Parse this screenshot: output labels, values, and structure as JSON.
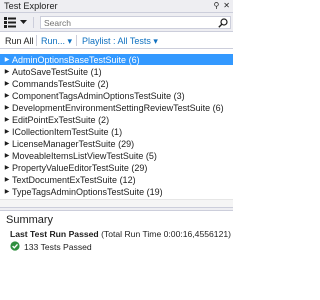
{
  "window": {
    "title": "Test Explorer",
    "pin_glyph": "⚲",
    "close_glyph": "✕"
  },
  "toolbar": {
    "group_by_icon": "group-by-icon",
    "dropdown_icon": "chevron-down-icon",
    "search": {
      "placeholder": "Search",
      "value": ""
    }
  },
  "commands": {
    "run_all": "Run All",
    "run": "Run...",
    "run_arrow": "▾",
    "playlist": "Playlist : All Tests",
    "playlist_arrow": "▾"
  },
  "colors": {
    "accent": "#0e70c0",
    "selection": "#3399ff",
    "passed": "#2f8f3f"
  },
  "tree": {
    "items": [
      {
        "name": "AdminOptionsBaseTestSuite",
        "count": "(6)",
        "selected": true
      },
      {
        "name": "AutoSaveTestSuite",
        "count": "(1)"
      },
      {
        "name": "CommandsTestSuite",
        "count": "(2)"
      },
      {
        "name": "ComponentTagsAdminOptionsTestSuite",
        "count": "(3)"
      },
      {
        "name": "DevelopmentEnvironmentSettingReviewTestSuite",
        "count": "(6)"
      },
      {
        "name": "EditPointExTestSuite",
        "count": "(2)"
      },
      {
        "name": "ICollectionItemTestSuite",
        "count": "(1)"
      },
      {
        "name": "LicenseManagerTestSuite",
        "count": "(29)"
      },
      {
        "name": "MoveableItemsListViewTestSuite",
        "count": "(5)"
      },
      {
        "name": "PropertyValueEditorTestSuite",
        "count": "(29)"
      },
      {
        "name": "TextDocumentExTestSuite",
        "count": "(12)"
      },
      {
        "name": "TypeTagsAdminOptionsTestSuite",
        "count": "(19)"
      }
    ]
  },
  "summary": {
    "heading": "Summary",
    "last_run_label": "Last Test Run Passed",
    "last_run_detail": "(Total Run Time 0:00:16,4556121)",
    "passed_text": "133 Tests Passed"
  }
}
